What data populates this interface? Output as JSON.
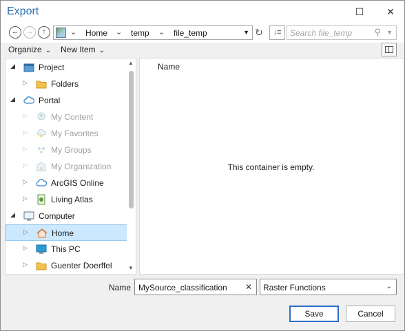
{
  "window": {
    "title": "Export",
    "maximize_glyph": "☐",
    "close_glyph": "✕"
  },
  "nav": {
    "back_glyph": "←",
    "forward_glyph": "→",
    "up_glyph": "↑",
    "breadcrumbs": [
      "Home",
      "temp",
      "file_temp"
    ],
    "chevron_glyph": "⌄",
    "dropdown_glyph": "▼",
    "refresh_glyph": "↻",
    "sort_glyph": "↓≡",
    "search_placeholder": "Search file_temp",
    "search_glyph": "⚲"
  },
  "toolbar": {
    "organize_label": "Organize",
    "new_item_label": "New Item",
    "chevron_glyph": "⌄"
  },
  "tree": {
    "items": [
      {
        "label": "Project",
        "icon": "project-icon",
        "level": 0,
        "expanded": true,
        "disabled": false
      },
      {
        "label": "Folders",
        "icon": "folder-icon",
        "level": 1,
        "expanded": false,
        "disabled": false
      },
      {
        "label": "Portal",
        "icon": "cloud-icon",
        "level": 0,
        "expanded": true,
        "disabled": false
      },
      {
        "label": "My Content",
        "icon": "my-content-icon",
        "level": 1,
        "expanded": false,
        "disabled": true
      },
      {
        "label": "My Favorites",
        "icon": "favorites-icon",
        "level": 1,
        "expanded": false,
        "disabled": true
      },
      {
        "label": "My Groups",
        "icon": "groups-icon",
        "level": 1,
        "expanded": false,
        "disabled": true
      },
      {
        "label": "My Organization",
        "icon": "organization-icon",
        "level": 1,
        "expanded": false,
        "disabled": true
      },
      {
        "label": "ArcGIS Online",
        "icon": "cloud-icon",
        "level": 1,
        "expanded": false,
        "disabled": false
      },
      {
        "label": "Living Atlas",
        "icon": "living-atlas-icon",
        "level": 1,
        "expanded": false,
        "disabled": false
      },
      {
        "label": "Computer",
        "icon": "computer-icon",
        "level": 0,
        "expanded": true,
        "disabled": false
      },
      {
        "label": "Home",
        "icon": "home-icon",
        "level": 1,
        "expanded": false,
        "disabled": false,
        "selected": true
      },
      {
        "label": "This PC",
        "icon": "monitor-icon",
        "level": 1,
        "expanded": false,
        "disabled": false
      },
      {
        "label": "Guenter Doerffel",
        "icon": "folder-icon",
        "level": 1,
        "expanded": false,
        "disabled": false
      }
    ],
    "expanded_glyph": "◢",
    "collapsed_glyph": "▷",
    "scroll_up_glyph": "▲",
    "scroll_down_glyph": "▼"
  },
  "content": {
    "column_header": "Name",
    "empty_message": "This container is empty."
  },
  "footer": {
    "name_label": "Name",
    "name_value": "MySource_classification",
    "clear_glyph": "✕",
    "type_value": "Raster Functions",
    "type_chevron_glyph": "⌄",
    "save_label": "Save",
    "cancel_label": "Cancel"
  },
  "colors": {
    "title": "#2e6fb7",
    "selection_bg": "#cce8ff",
    "primary_border": "#2b6fc7"
  }
}
